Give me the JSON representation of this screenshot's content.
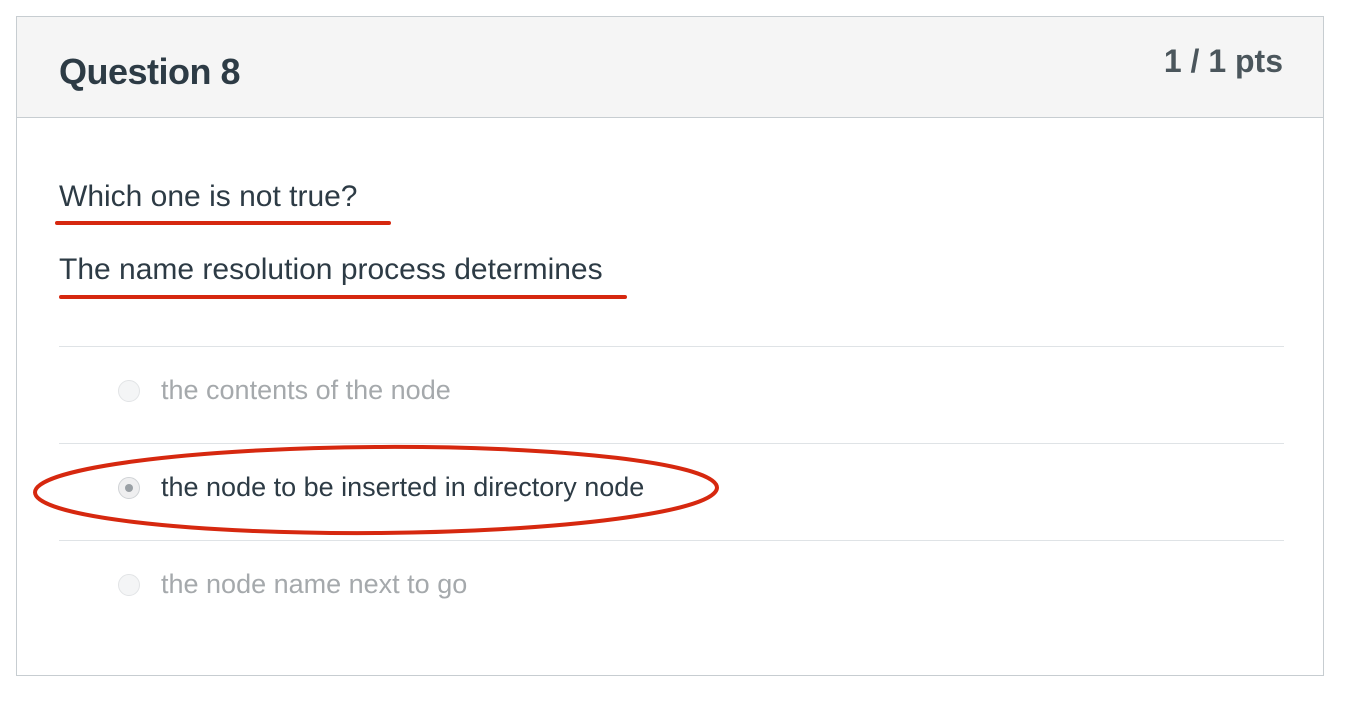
{
  "question": {
    "title": "Question 8",
    "points": "1 / 1 pts",
    "text_line1": "Which one is not true?",
    "text_line2": "The name resolution process determines"
  },
  "answers": [
    {
      "label": "the contents of the node",
      "selected": false
    },
    {
      "label": "the node to be inserted in directory node",
      "selected": true
    },
    {
      "label": "the node name next to go",
      "selected": false
    }
  ],
  "annotations": {
    "mark_color": "#d6280f"
  }
}
